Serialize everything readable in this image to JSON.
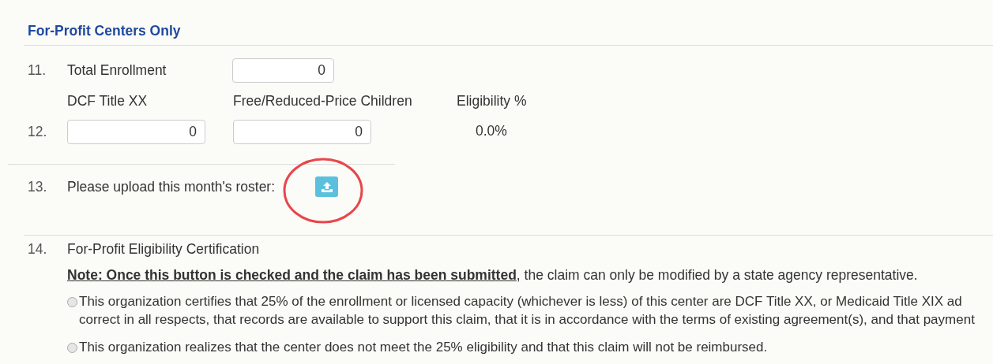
{
  "section": {
    "title": "For-Profit Centers Only"
  },
  "row_11": {
    "number": "11.",
    "label": "Total Enrollment",
    "value": "0"
  },
  "row_12": {
    "number": "12.",
    "columns": [
      {
        "kind": "field",
        "heading": "DCF Title XX",
        "value": "0"
      },
      {
        "kind": "field",
        "heading": "Free/Reduced-Price Children",
        "value": "0"
      },
      {
        "kind": "reading",
        "heading": "Eligibility %",
        "value": "0.0%"
      }
    ]
  },
  "row_13": {
    "number": "13.",
    "label": "Please upload this month's roster:",
    "upload_button": {
      "highlighted": true
    }
  },
  "row_14": {
    "number": "14.",
    "label": "For-Profit Eligibility Certification",
    "note": "**Note: Once this button is checked and the claim has been submitted**, the claim can only be modified by a state agency representative.",
    "options": [
      {
        "selected": false,
        "lines": [
          "This organization certifies that 25% of the enrollment or licensed capacity (whichever is less) of this center are DCF Title XX, or Medicaid Title XIX ad",
          "correct in all respects, that records are available to support this claim, that it is in accordance with the terms of existing agreement(s), and that payment"
        ]
      },
      {
        "selected": false,
        "lines": [
          "This organization realizes that the center does not meet the 25% eligibility and that this claim will not be reimbursed."
        ]
      }
    ]
  }
}
